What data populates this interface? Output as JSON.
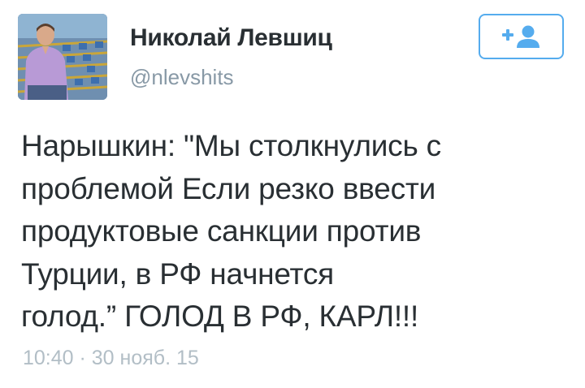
{
  "tweet": {
    "author": {
      "display_name": "Николай Левшиц",
      "screen_name": "@nlevshits"
    },
    "follow_button": {
      "icon": "add-user-icon",
      "accent": "#55acee"
    },
    "text": "Нарышкин: \"Мы столкнулись с\nпроблемой Если резко ввести\nпродуктовые санкции против\nТурции, в РФ начнется\nголод.” ГОЛОД В РФ, КАРЛ!!!",
    "timestamp": "10:40 · 30 нояб. 15"
  },
  "colors": {
    "text": "#292f33",
    "secondary": "#8899a6",
    "timestamp": "#b2bec6",
    "accent": "#55acee"
  }
}
